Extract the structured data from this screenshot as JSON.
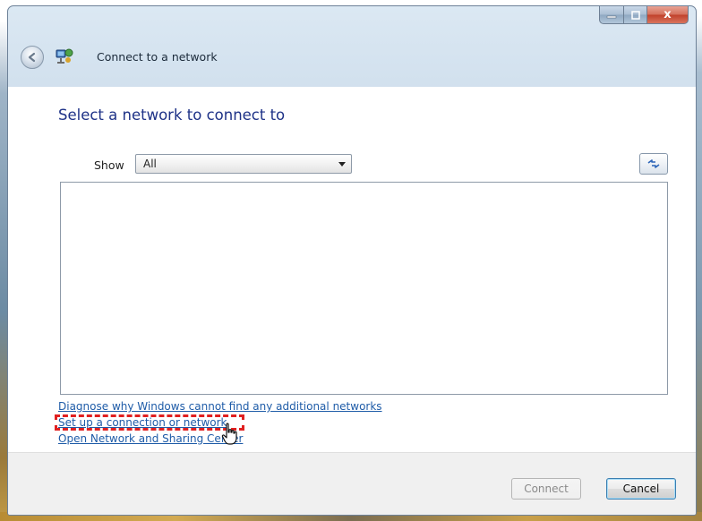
{
  "window": {
    "title": "Connect to a network",
    "caption_buttons": {
      "minimize_icon": "minimize-icon",
      "maximize_icon": "maximize-icon",
      "close_glyph": "x"
    }
  },
  "heading": "Select a network to connect to",
  "filter": {
    "label": "Show",
    "selected": "All"
  },
  "network_list": [],
  "links": {
    "diagnose": "Diagnose why Windows cannot find any additional networks",
    "setup": "Set up a connection or network",
    "open_center": "Open Network and Sharing Center"
  },
  "buttons": {
    "connect": "Connect",
    "cancel": "Cancel"
  },
  "colors": {
    "heading": "#1e3287",
    "link": "#1f5ca8",
    "highlight": "#e02020",
    "close_button": "#c0402a"
  },
  "icons": [
    "back-arrow-icon",
    "network-icon",
    "refresh-icon",
    "chevron-down-icon",
    "hand-cursor-icon"
  ]
}
